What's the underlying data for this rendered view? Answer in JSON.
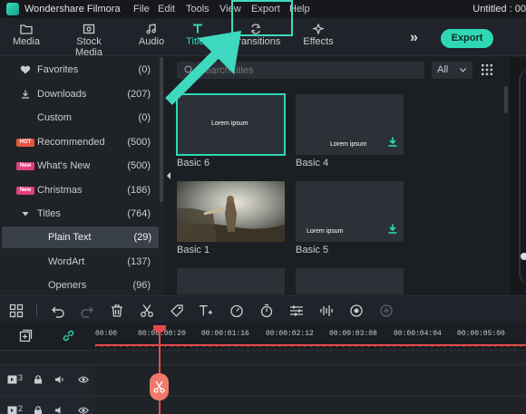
{
  "app": {
    "name": "Wondershare Filmora",
    "document_title": "Untitled : 00",
    "menu": [
      "File",
      "Edit",
      "Tools",
      "View",
      "Export",
      "Help"
    ]
  },
  "toolbar": {
    "tabs": [
      {
        "label": "Media",
        "icon": "folder-icon",
        "active": false
      },
      {
        "label": "Stock Media",
        "icon": "stock-media-icon",
        "active": false
      },
      {
        "label": "Audio",
        "icon": "music-note-icon",
        "active": false
      },
      {
        "label": "Titles",
        "icon": "text-t-icon",
        "active": true
      },
      {
        "label": "Transitions",
        "icon": "transition-icon",
        "active": false
      },
      {
        "label": "Effects",
        "icon": "sparkle-icon",
        "active": false
      }
    ],
    "more_icon": "double-chevron-right-icon",
    "export_label": "Export",
    "accent_color": "#2fd8b5"
  },
  "sidebar": {
    "items": [
      {
        "label": "Favorites",
        "count": "(0)",
        "icon": "heart-icon"
      },
      {
        "label": "Downloads",
        "count": "(207)",
        "icon": "download-icon"
      },
      {
        "label": "Custom",
        "count": "(0)",
        "icon": ""
      },
      {
        "label": "Recommended",
        "count": "(500)",
        "badge": "HOT",
        "badge_color": "#e8553b"
      },
      {
        "label": "What's New",
        "count": "(500)",
        "badge": "New",
        "badge_color": "#e23f7e"
      },
      {
        "label": "Christmas",
        "count": "(186)",
        "badge": "New",
        "badge_color": "#e23f7e"
      },
      {
        "label": "Titles",
        "count": "(764)",
        "icon": "caret-down-icon"
      },
      {
        "label": "Plain Text",
        "count": "(29)",
        "selected": true
      },
      {
        "label": "WordArt",
        "count": "(137)"
      },
      {
        "label": "Openers",
        "count": "(96)"
      }
    ]
  },
  "content": {
    "search_placeholder": "Search titles",
    "filter_value": "All",
    "thumbnails": [
      {
        "name": "Basic 6",
        "preview_text": "Lorem ipsum",
        "selected": true,
        "downloadable": false
      },
      {
        "name": "Basic 4",
        "preview_text": "Lorem ipsum",
        "selected": false,
        "downloadable": true
      },
      {
        "name": "Basic 1",
        "preview_text": "",
        "selected": false,
        "downloadable": false,
        "photo": true
      },
      {
        "name": "Basic 5",
        "preview_text": "Lorem ipsum",
        "selected": false,
        "downloadable": true
      }
    ]
  },
  "timeline": {
    "tools": [
      "layout-icon",
      "undo-icon",
      "redo-icon",
      "trash-icon",
      "scissors-icon",
      "tag-icon",
      "text-plus-icon",
      "speed-icon",
      "timer-icon",
      "adjust-icon",
      "audio-wave-icon",
      "color-icon",
      "stabilize-icon"
    ],
    "ruler": [
      "00:00",
      "00:00:00:20",
      "00:00:01:16",
      "00:00:02:12",
      "00:00:03:08",
      "00:00:04:04",
      "00:00:05:00"
    ],
    "tracks": [
      {
        "number": "3"
      },
      {
        "number": "2"
      }
    ]
  }
}
